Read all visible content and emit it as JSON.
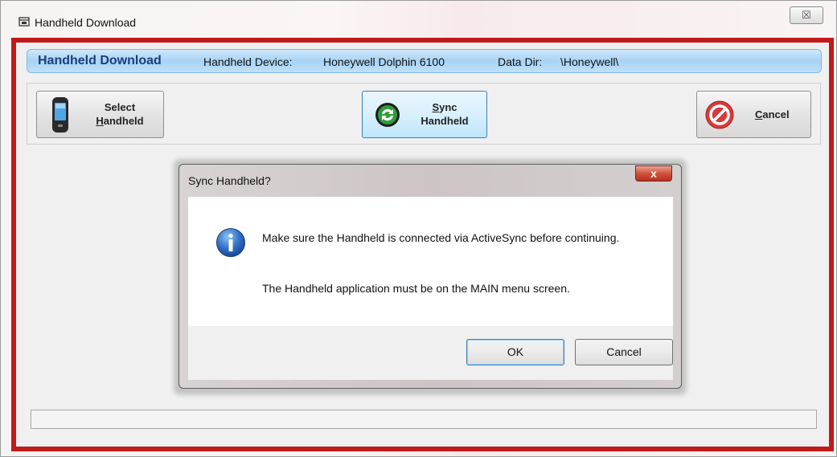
{
  "window": {
    "title": "Handheld Download",
    "close_glyph": "☒"
  },
  "infobar": {
    "title": "Handheld Download",
    "device_label": "Handheld Device:",
    "device_value": "Honeywell Dolphin 6100",
    "dir_label": "Data Dir:",
    "dir_value": "\\Honeywell\\"
  },
  "toolbar": {
    "select": {
      "line1": "Select",
      "line2_first": "H",
      "line2_rest": "andheld",
      "icon": "handheld-phone-icon"
    },
    "sync": {
      "line1_first": "S",
      "line1_rest": "ync",
      "line2": "Handheld",
      "icon": "sync-arrows-icon"
    },
    "cancel": {
      "first": "C",
      "rest": "ancel",
      "icon": "no-entry-icon"
    }
  },
  "dialog": {
    "title": "Sync Handheld?",
    "close_glyph": "x",
    "message1": "Make sure the Handheld is connected via ActiveSync before continuing.",
    "message2": "The Handheld application must be on the MAIN menu screen.",
    "ok_label": "OK",
    "cancel_label": "Cancel",
    "icon": "info-icon"
  },
  "colors": {
    "frame": "#c11a1a",
    "infobar_title": "#1a3f7a",
    "sync_accent": "#3c7fb1"
  }
}
